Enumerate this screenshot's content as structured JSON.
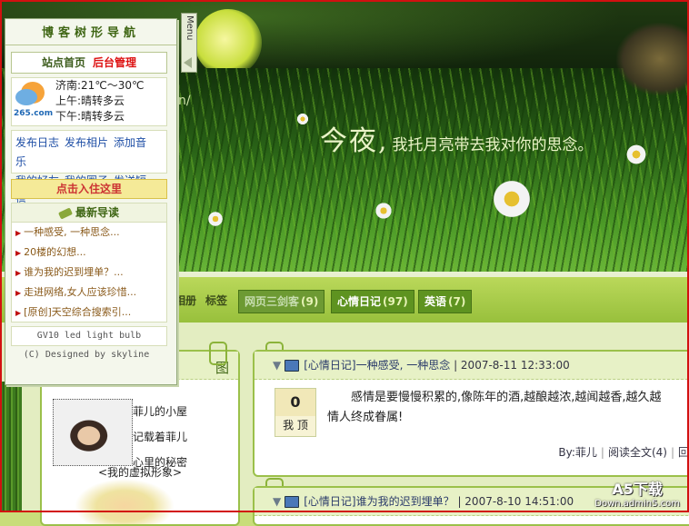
{
  "banner": {
    "caption_big": "今夜,",
    "caption_small": "我托月亮带去我对你的思念。",
    "slash": "n/"
  },
  "nav_panel": {
    "title": "博客树形导航",
    "site_home": "站点首页",
    "admin": "后台管理",
    "menu_tab": "Menu",
    "weather": {
      "logo": "265.com",
      "city_temp": "济南:21℃～30℃",
      "morning": "上午:晴转多云",
      "afternoon": "下午:晴转多云"
    },
    "links": [
      "发布日志",
      "发布相片",
      "添加音乐",
      "我的好友",
      "我的圈子",
      "发送短信"
    ],
    "cta": "点击入住这里",
    "latest_title": "最新导读",
    "latest_items": [
      "一种感受, 一种思念...",
      "20楼的幻想...",
      "谁为我的迟到埋单？...",
      "走进网络,女人应该珍惜...",
      "[原创]天空综合搜索引..."
    ],
    "version": "GV10 led light bulb",
    "copyright": "(C) Designed by skyline"
  },
  "nav_strip": {
    "items": [
      {
        "label": "相册",
        "count": ""
      },
      {
        "label": "标签",
        "count": ""
      },
      {
        "label": "网页三剑客",
        "count": "(9)"
      },
      {
        "label": "心情日记",
        "count": "(97)"
      },
      {
        "label": "英语",
        "count": "(7)"
      }
    ]
  },
  "profile": {
    "header": "图",
    "lines": [
      "菲儿的小屋",
      "记载着菲儿",
      "心里的秘密"
    ],
    "photo_caption": "<我的虚拟形象>"
  },
  "posts": [
    {
      "title": "[心情日记]一种感受, 一种思念",
      "date": "2007-8-11  12:33:00",
      "votes": "0",
      "vote_label": "我 顶",
      "body_line1": "感情是要慢慢积累的,像陈年的酒,越酿越浓,越闻越香,越久越",
      "body_line2": "情人终成眷属!",
      "author": "By:菲儿",
      "read_more": "阅读全文(4)",
      "more": "回"
    },
    {
      "title": "[心情日记]谁为我的迟到埋单？",
      "date": "2007-8-10  14:51:00"
    }
  ],
  "watermark": {
    "brand": "A5下载",
    "site": "Down.admin5.com"
  },
  "colors": {
    "accent": "#9bc04a",
    "admin_red": "#dd1111",
    "link_blue": "#1f4fa6"
  }
}
